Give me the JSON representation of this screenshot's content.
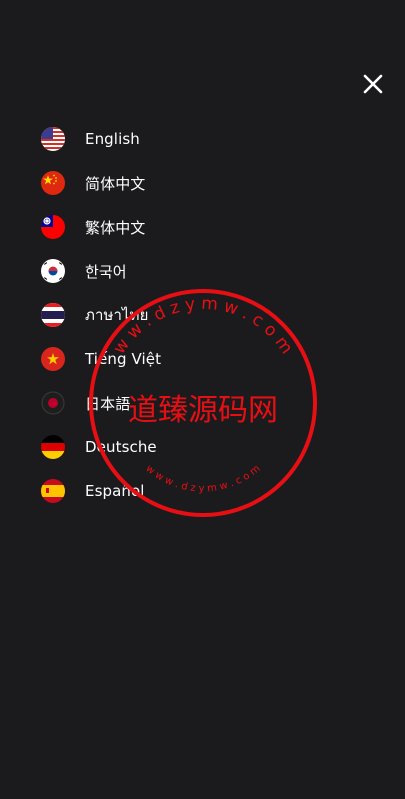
{
  "menu": {
    "close_icon": "close-icon",
    "languages": [
      {
        "label": "English",
        "flag": "us-flag-icon"
      },
      {
        "label": "简体中文",
        "flag": "cn-flag-icon"
      },
      {
        "label": "繁体中文",
        "flag": "tw-flag-icon"
      },
      {
        "label": "한국어",
        "flag": "kr-flag-icon"
      },
      {
        "label": "ภาษาไทย",
        "flag": "th-flag-icon"
      },
      {
        "label": "Tiếng Việt",
        "flag": "vn-flag-icon"
      },
      {
        "label": "日本語",
        "flag": "jp-flag-icon"
      },
      {
        "label": "Deutsche",
        "flag": "de-flag-icon"
      },
      {
        "label": "Español",
        "flag": "es-flag-icon"
      }
    ]
  },
  "watermark": {
    "center_text": "道臻源码网",
    "ring_top": "w w . d z y m w . c o m",
    "ring_bottom": "w w w . d z y m w . c o m",
    "color": "#e80f14"
  },
  "colors": {
    "background": "#1b1b1d",
    "text": "#ffffff"
  }
}
